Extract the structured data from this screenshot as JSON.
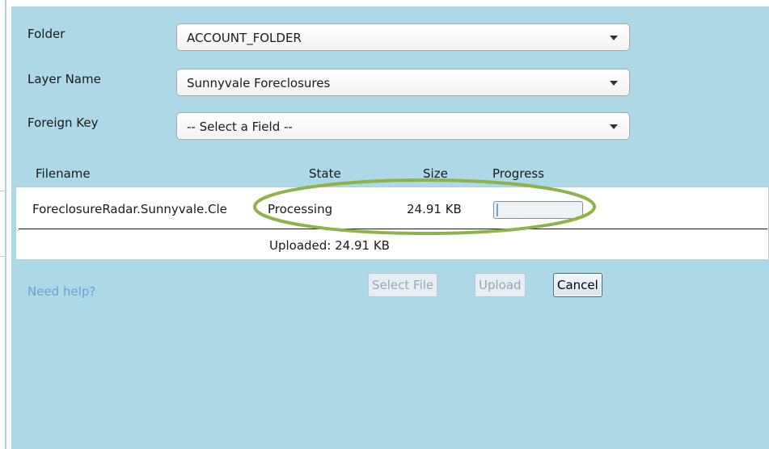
{
  "form": {
    "folder": {
      "label": "Folder",
      "value": "ACCOUNT_FOLDER"
    },
    "layer_name": {
      "label": "Layer Name",
      "value": "Sunnyvale Foreclosures"
    },
    "foreign_key": {
      "label": "Foreign Key",
      "value": "-- Select a Field --"
    }
  },
  "file_table": {
    "headers": {
      "filename": "Filename",
      "state": "State",
      "size": "Size",
      "progress": "Progress"
    },
    "row": {
      "filename": "ForeclosureRadar.Sunnyvale.Cle",
      "state": "Processing",
      "size": "24.91 KB",
      "progress_percent": 3
    },
    "uploaded_text": "Uploaded: 24.91 KB"
  },
  "footer": {
    "help_link": "Need help?",
    "select_file_label": "Select File",
    "upload_label": "Upload",
    "cancel_label": "Cancel"
  },
  "colors": {
    "panel_background": "#add8e6",
    "highlight_ellipse": "#8db34a",
    "help_link": "#6fa0d8"
  }
}
